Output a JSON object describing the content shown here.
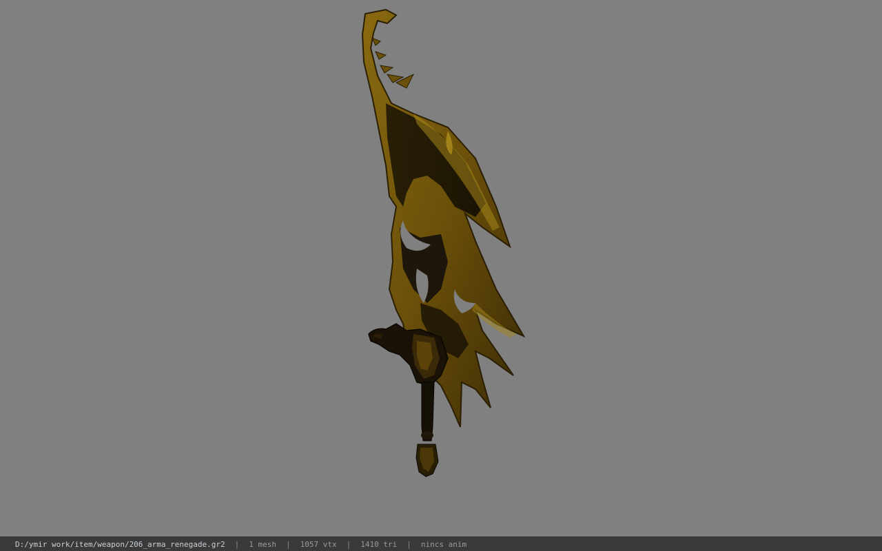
{
  "viewport": {
    "background": "#808080",
    "model_name": "206_arma_renegade"
  },
  "status": {
    "path": "D:/ymir work/item/weapon/206_arma_renegade.gr2",
    "separator": "|",
    "meshes": "1 mesh",
    "vertices": "1057 vtx",
    "triangles": "1410 tri",
    "animation": "nincs anim"
  }
}
